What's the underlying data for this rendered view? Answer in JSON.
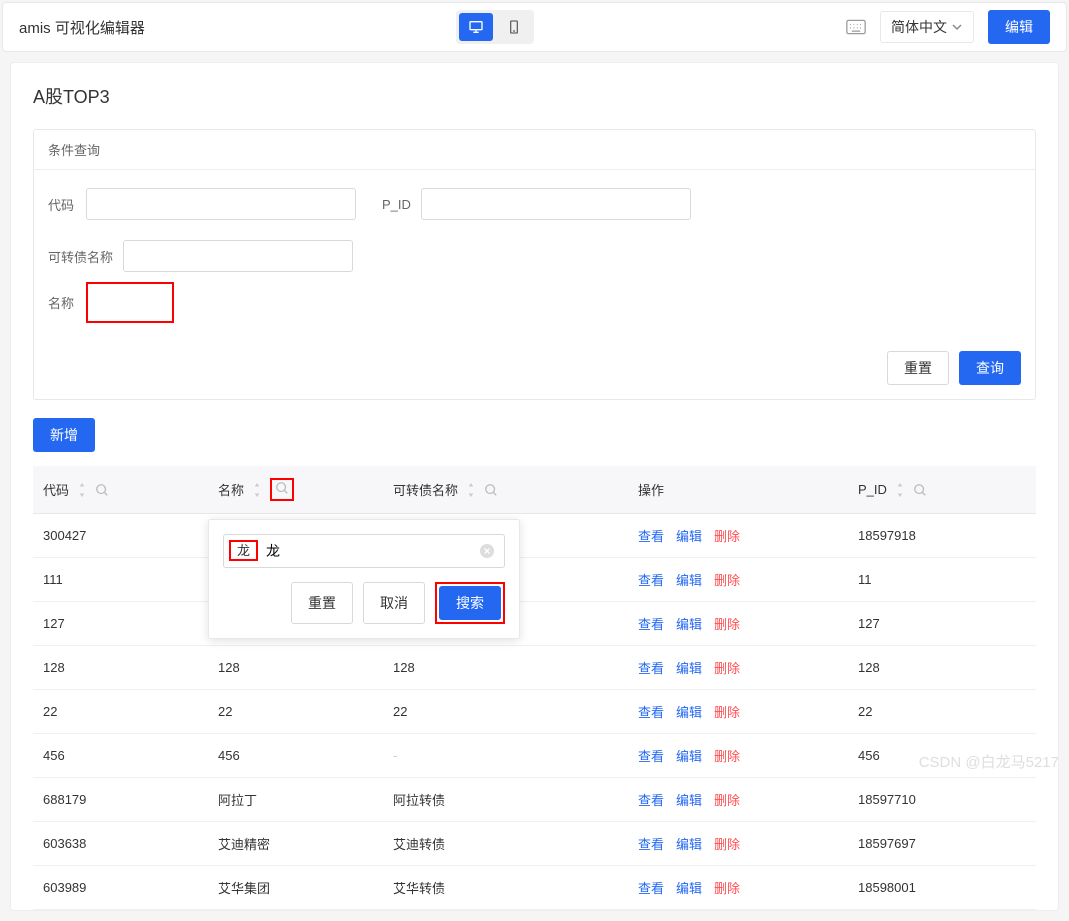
{
  "header": {
    "app_title": "amis 可视化编辑器",
    "lang": "简体中文",
    "edit_btn": "编辑"
  },
  "page": {
    "title": "A股TOP3"
  },
  "filter": {
    "panel_title": "条件查询",
    "code_label": "代码",
    "pid_label": "P_ID",
    "bond_label": "可转债名称",
    "name_label": "名称",
    "reset_btn": "重置",
    "query_btn": "查询"
  },
  "toolbar": {
    "add_btn": "新增"
  },
  "table": {
    "cols": {
      "code": "代码",
      "name": "名称",
      "bond": "可转债名称",
      "ops": "操作",
      "pid": "P_ID"
    },
    "ops": {
      "view": "查看",
      "edit": "编辑",
      "del": "删除"
    },
    "rows": [
      {
        "code": "300427",
        "name": "",
        "bond": "",
        "pid": "18597918"
      },
      {
        "code": "111",
        "name": "",
        "bond": "",
        "pid": "11"
      },
      {
        "code": "127",
        "name": "",
        "bond": "",
        "pid": "127"
      },
      {
        "code": "128",
        "name": "128",
        "bond": "128",
        "pid": "128"
      },
      {
        "code": "22",
        "name": "22",
        "bond": "22",
        "pid": "22"
      },
      {
        "code": "456",
        "name": "456",
        "bond": "-",
        "pid": "456"
      },
      {
        "code": "688179",
        "name": "阿拉丁",
        "bond": "阿拉转债",
        "pid": "18597710"
      },
      {
        "code": "603638",
        "name": "艾迪精密",
        "bond": "艾迪转债",
        "pid": "18597697"
      },
      {
        "code": "603989",
        "name": "艾华集团",
        "bond": "艾华转债",
        "pid": "18598001"
      }
    ]
  },
  "popover": {
    "value": "龙",
    "reset": "重置",
    "cancel": "取消",
    "search": "搜索"
  },
  "watermark": "CSDN @白龙马5217"
}
